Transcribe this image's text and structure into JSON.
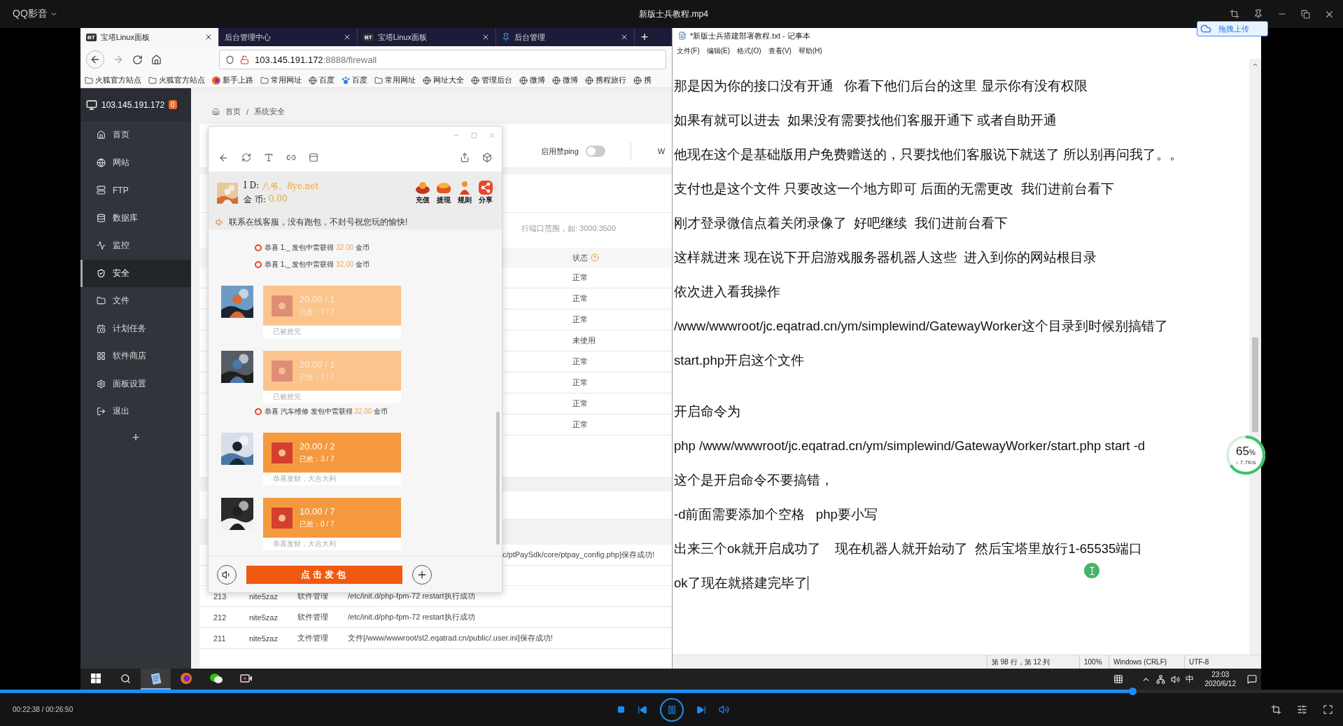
{
  "player": {
    "app_name": "QQ影音",
    "title": "新版士兵教程.mp4",
    "time": "00:22:38 / 00:26:50",
    "progress": {
      "level": 0.843
    },
    "playing": true
  },
  "upload_badge": {
    "label": "拖拽上传"
  },
  "speed_widget": {
    "percent": "65",
    "unit": "%",
    "rate": "↓ 7.7K/s",
    "level": 0.65
  },
  "browser": {
    "tabs": [
      {
        "label": "宝塔Linux面板",
        "kind": "bt",
        "mark": "BT",
        "selected": true
      },
      {
        "label": "后台管理中心",
        "kind": "none",
        "selected": false
      },
      {
        "label": "宝塔Linux面板",
        "kind": "bt",
        "mark": "BT",
        "selected": false
      },
      {
        "label": "后台管理",
        "kind": "pin",
        "selected": false
      }
    ],
    "new_tab": "+",
    "address": {
      "host": "103.145.191.172",
      "path": ":8888/firewall"
    },
    "bookmarks": [
      {
        "label": "火狐官方站点",
        "kind": "folder"
      },
      {
        "label": "火狐官方站点",
        "kind": "folder"
      },
      {
        "label": "新手上路",
        "kind": "firefox"
      },
      {
        "label": "常用网址",
        "kind": "folder"
      },
      {
        "label": "百度",
        "kind": "globe"
      },
      {
        "label": "百度",
        "kind": "paw"
      },
      {
        "label": "常用网址",
        "kind": "folder"
      },
      {
        "label": "网址大全",
        "kind": "globe"
      },
      {
        "label": "管理后台",
        "kind": "globe"
      },
      {
        "label": "微博",
        "kind": "globe"
      },
      {
        "label": "微博",
        "kind": "globe"
      },
      {
        "label": "携程旅行",
        "kind": "globe"
      },
      {
        "label": "携",
        "kind": "globe"
      }
    ]
  },
  "panel": {
    "server": "103.145.191.172",
    "badge": "0",
    "nav": [
      {
        "label": "首页",
        "kind": "home",
        "selected": false
      },
      {
        "label": "网站",
        "kind": "site",
        "selected": false
      },
      {
        "label": "FTP",
        "kind": "ftp",
        "selected": false
      },
      {
        "label": "数据库",
        "kind": "database",
        "selected": false
      },
      {
        "label": "监控",
        "kind": "monitor",
        "selected": false
      },
      {
        "label": "安全",
        "kind": "security",
        "selected": true
      },
      {
        "label": "文件",
        "kind": "files",
        "selected": false
      },
      {
        "label": "计划任务",
        "kind": "tasks",
        "selected": false
      },
      {
        "label": "软件商店",
        "kind": "store",
        "selected": false
      },
      {
        "label": "面板设置",
        "kind": "settings",
        "selected": false
      },
      {
        "label": "退出",
        "kind": "logout",
        "selected": false
      }
    ],
    "add": "+",
    "breadcrumb": [
      "首页",
      "系统安全"
    ],
    "breadcrumb_separator": "/",
    "ping": {
      "label": "启用禁ping",
      "on": false
    },
    "toolbar_cut": "W",
    "hint": "行端口范围，如: 3000:3500",
    "status_header": "状态",
    "status_rows": [
      "正常",
      "正常",
      "正常",
      "未使用",
      "正常",
      "正常",
      "正常",
      "正常"
    ],
    "log_cut": "c/ptPaySdk/core/ptpay_config.php]保存成功!",
    "logs": [
      {
        "id": "213",
        "user": "nite5zaz",
        "type": "软件管理",
        "detail": "/etc/init.d/php-fpm-72 restart执行成功"
      },
      {
        "id": "212",
        "user": "nite5zaz",
        "type": "软件管理",
        "detail": "/etc/init.d/php-fpm-72 restart执行成功"
      },
      {
        "id": "211",
        "user": "nite5zaz",
        "type": "文件管理",
        "detail": "文件[/www/wwwroot/sl2.eqatrad.cn/public/.user.ini]保存成功!"
      }
    ]
  },
  "chat": {
    "id_label": "I  D:",
    "user_id": "八爷。8ye.net",
    "coins_label": "金 币:",
    "coins": "0.00",
    "actions": [
      {
        "label": "充值",
        "kind": "recharge"
      },
      {
        "label": "提现",
        "kind": "withdraw"
      },
      {
        "label": "规则",
        "kind": "rules"
      },
      {
        "label": "分享",
        "kind": "share"
      }
    ],
    "notice": "联系在线客服，没有跑包，不封号祝您玩的愉快!",
    "messages": [
      {
        "kind": "system",
        "text": "恭喜 1._ 发包中雷获得",
        "amount": "32.00",
        "unit": "金币"
      },
      {
        "kind": "system",
        "text": "恭喜 1._ 发包中雷获得",
        "amount": "32.00",
        "unit": "金币"
      },
      {
        "kind": "packet",
        "amount": "20.00 / 1",
        "grabbed": "已抢：7 / 7",
        "caption": "已被抢完",
        "claimed": true
      },
      {
        "kind": "packet",
        "amount": "20.00 / 1",
        "grabbed": "已抢：7 / 7",
        "caption": "已被抢完",
        "claimed": true
      },
      {
        "kind": "system",
        "text": "恭喜 汽车维修 发包中雷获得",
        "amount": "32.00",
        "unit": "金币"
      },
      {
        "kind": "packet",
        "amount": "20.00 / 2",
        "grabbed": "已抢：3 / 7",
        "caption": "恭喜发财，大吉大利",
        "claimed": false
      },
      {
        "kind": "packet",
        "amount": "10.00 / 7",
        "grabbed": "已抢：0 / 7",
        "caption": "恭喜发财，大吉大利",
        "claimed": false
      }
    ],
    "send_button": "点击发包"
  },
  "notepad": {
    "title": "*新版士兵搭建部署教程.txt - 记事本",
    "menu": [
      "文件(F)",
      "编辑(E)",
      "格式(O)",
      "查看(V)",
      "帮助(H)"
    ],
    "lines": [
      {
        "kind": "text",
        "text": "那是因为你的接口没有开通   你看下他们后台的这里 显示你有没有权限"
      },
      {
        "kind": "text",
        "text": "如果有就可以进去  如果没有需要找他们客服开通下 或者自助开通"
      },
      {
        "kind": "text",
        "text": "他现在这个是基础版用户免费赠送的，只要找他们客服说下就送了 所以别再问我了。。"
      },
      {
        "kind": "text",
        "text": "支付也是这个文件 只要改这一个地方即可 后面的无需更改  我们进前台看下"
      },
      {
        "kind": "text",
        "text": "刚才登录微信点着关闭录像了  好吧继续  我们进前台看下"
      },
      {
        "kind": "text",
        "text": "这样就进来 现在说下开启游戏服务器机器人这些  进入到你的网站根目录"
      },
      {
        "kind": "text",
        "text": "依次进入看我操作"
      },
      {
        "kind": "text",
        "text": "/www/wwwroot/jc.eqatrad.cn/ym/simplewind/GatewayWorker这个目录到时候别搞错了"
      },
      {
        "kind": "text",
        "text": "start.php开启这个文件"
      },
      {
        "kind": "blank"
      },
      {
        "kind": "text",
        "text": "开启命令为"
      },
      {
        "kind": "text",
        "text": "php /www/wwwroot/jc.eqatrad.cn/ym/simplewind/GatewayWorker/start.php start -d"
      },
      {
        "kind": "text",
        "text": "这个是开启命令不要搞错，"
      },
      {
        "kind": "text",
        "text": "-d前面需要添加个空格   php要小写"
      },
      {
        "kind": "text",
        "text": "出来三个ok就开启成功了    现在机器人就开始动了  然后宝塔里放行1-65535端口"
      },
      {
        "kind": "text",
        "text": "ok了现在就搭建完毕了"
      }
    ],
    "status": [
      "第 98 行，第 12 列",
      "100%",
      "Windows (CRLF)",
      "UTF-8"
    ]
  },
  "taskbar": {
    "apps": [
      {
        "kind": "notepad",
        "selected": true
      },
      {
        "kind": "firefox",
        "selected": false
      },
      {
        "kind": "wechat",
        "selected": false
      },
      {
        "kind": "recorder",
        "selected": false
      }
    ],
    "ime": "中",
    "time": "23:03",
    "date": "2020/6/12"
  }
}
